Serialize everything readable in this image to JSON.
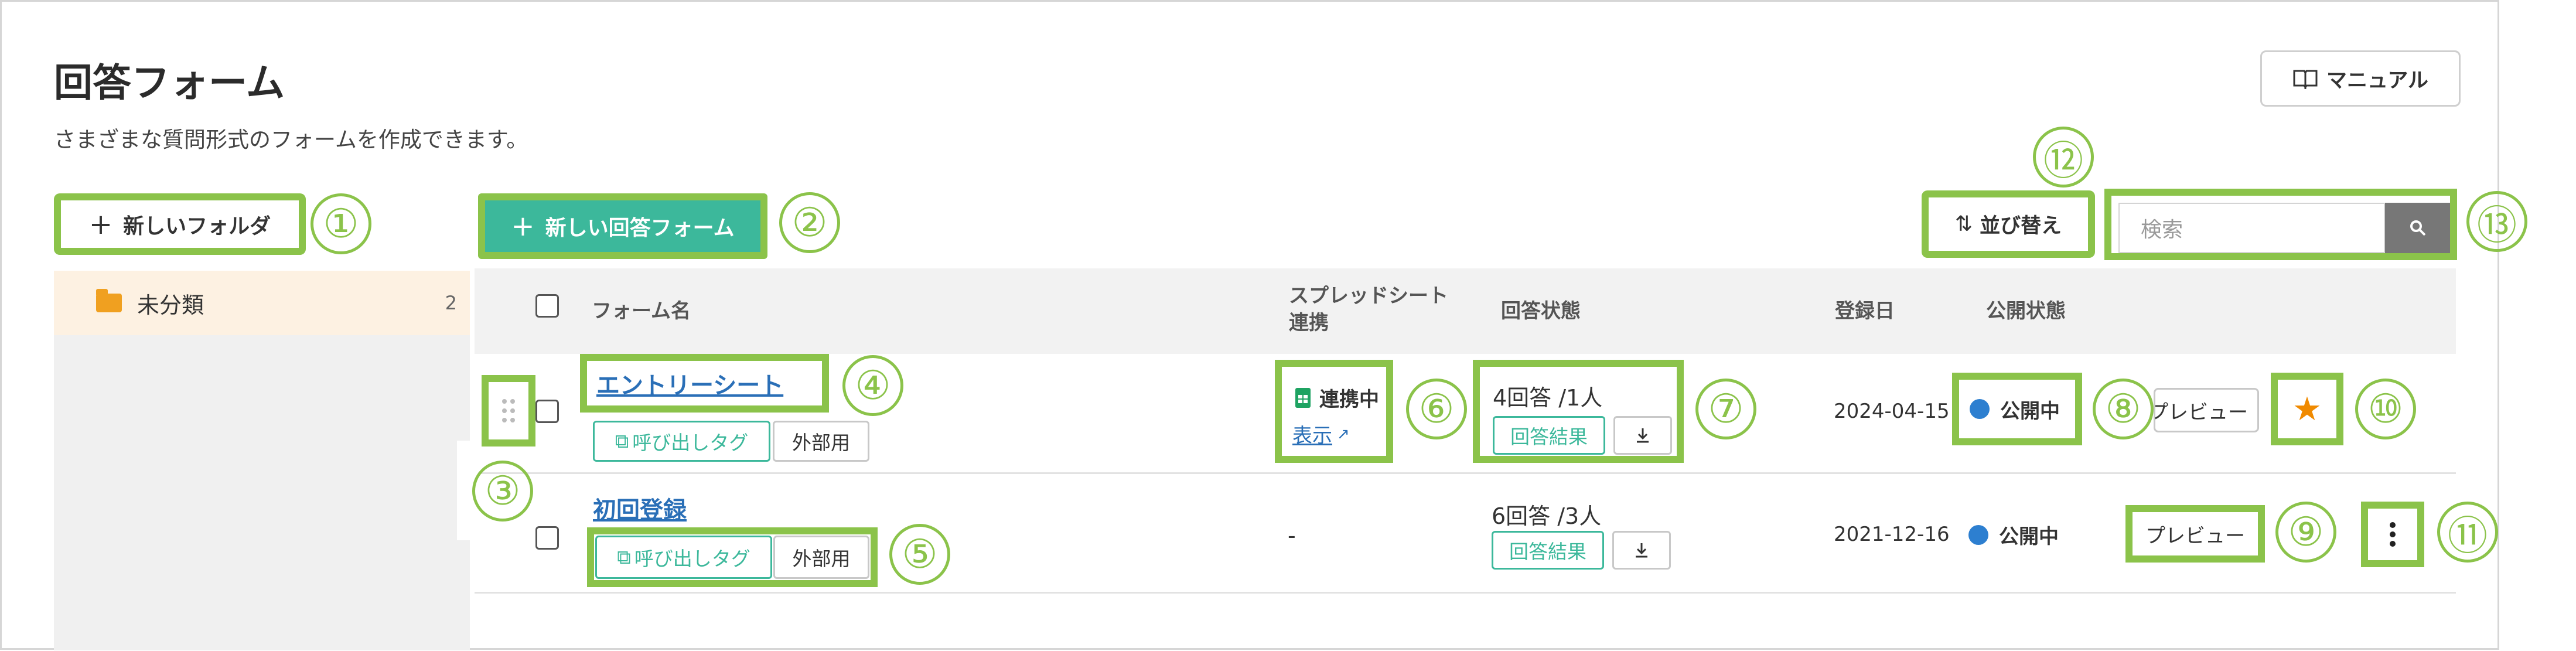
{
  "page": {
    "title": "回答フォーム",
    "subtitle": "さまざまな質問形式のフォームを作成できます。",
    "manual_label": "マニュアル"
  },
  "toolbar": {
    "new_folder_label": "新しいフォルダ",
    "new_form_label": "新しい回答フォーム",
    "sort_label": "並び替え",
    "search_placeholder": "検索"
  },
  "sidebar": {
    "folders": [
      {
        "label": "未分類",
        "count": "2"
      }
    ]
  },
  "table": {
    "headers": {
      "form_name": "フォーム名",
      "spreadsheet_1": "スプレッドシート",
      "spreadsheet_2": "連携",
      "answer_status": "回答状態",
      "registered": "登録日",
      "public_status": "公開状態"
    },
    "rows": [
      {
        "name": "エントリーシート",
        "call_tag": "呼び出しタグ",
        "external": "外部用",
        "sheet_status": "連携中",
        "sheet_view": "表示",
        "answers": "4回答 /1人",
        "results_label": "回答結果",
        "date": "2024-04-15",
        "status": "公開中",
        "preview_label": "プレビュー"
      },
      {
        "name": "初回登録",
        "call_tag": "呼び出しタグ",
        "external": "外部用",
        "sheet_status": "-",
        "answers": "6回答 /3人",
        "results_label": "回答結果",
        "date": "2021-12-16",
        "status": "公開中",
        "preview_label": "プレビュー"
      }
    ]
  },
  "callouts": [
    "①",
    "②",
    "③",
    "④",
    "⑤",
    "⑥",
    "⑦",
    "⑧",
    "⑨",
    "⑩",
    "⑪",
    "⑫",
    "⑬"
  ],
  "colors": {
    "accent_green": "#3cb89b",
    "highlight": "#8bc34a",
    "link": "#2a6fb7",
    "status_dot": "#2d7fd0",
    "star": "#f08a00",
    "folder": "#f0a020"
  }
}
